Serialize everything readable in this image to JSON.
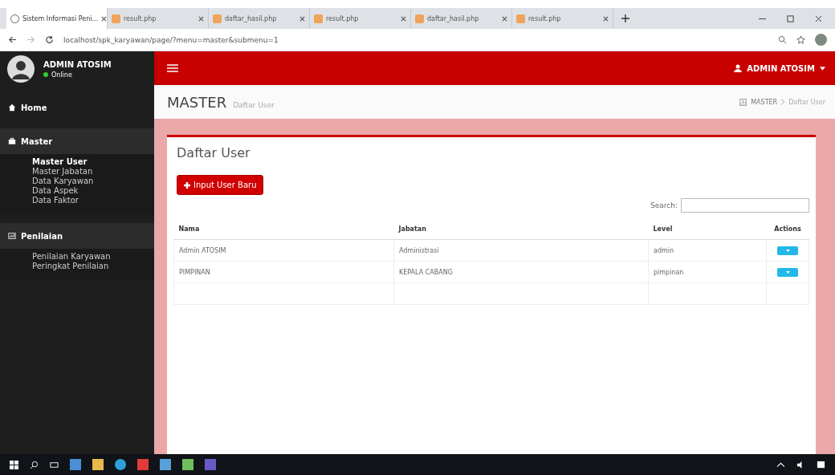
{
  "browser": {
    "tabs": [
      {
        "label": "Sistem Informasi Peni...",
        "selected": true
      },
      {
        "label": "result.php",
        "selected": false
      },
      {
        "label": "daftar_hasil.php",
        "selected": false
      },
      {
        "label": "result.php",
        "selected": false
      },
      {
        "label": "daftar_hasil.php",
        "selected": false
      },
      {
        "label": "result.php",
        "selected": false
      }
    ],
    "url": "localhost/spk_karyawan/page/?menu=master&submenu=1"
  },
  "sidebar": {
    "user": {
      "name": "ADMIN ATOSIM",
      "status": "Online"
    },
    "sections": [
      {
        "label": "Home",
        "expanded": false
      },
      {
        "label": "Master",
        "expanded": true,
        "items": [
          {
            "label": "Master User",
            "selected": true
          },
          {
            "label": "Master Jabatan",
            "selected": false
          },
          {
            "label": "Data Karyawan",
            "selected": false
          },
          {
            "label": "Data Aspek",
            "selected": false
          },
          {
            "label": "Data Faktor",
            "selected": false
          }
        ]
      },
      {
        "label": "Penilaian",
        "expanded": true,
        "items": [
          {
            "label": "Penilaian Karyawan",
            "selected": false
          },
          {
            "label": "Peringkat Penilaian",
            "selected": false
          }
        ]
      }
    ]
  },
  "header": {
    "user": "ADMIN ATOSIM"
  },
  "page": {
    "title": "MASTER",
    "subtitle": "Daftar User",
    "breadcrumb": [
      "MASTER",
      "Daftar User"
    ]
  },
  "box": {
    "title": "Daftar User",
    "add_button": "Input User Baru",
    "search_label": "Search:",
    "table": {
      "columns": [
        "Nama",
        "Jabatan",
        "Level",
        "Actions"
      ],
      "rows": [
        [
          "Admin ATOSIM",
          "Administrasi",
          "admin"
        ],
        [
          "PIMPINAN",
          "KEPALA CABANG",
          "pimpinan"
        ]
      ]
    }
  }
}
